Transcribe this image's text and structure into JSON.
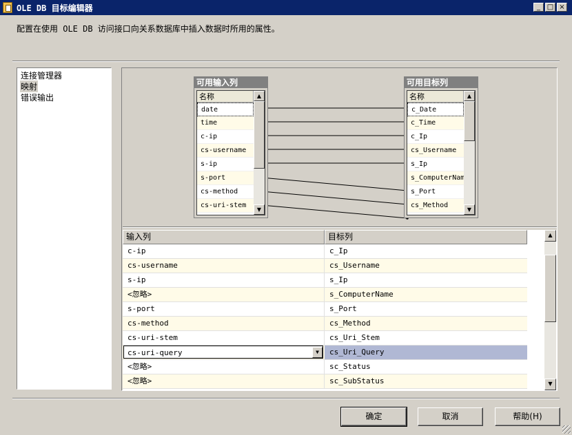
{
  "window": {
    "title": "OLE DB 目标编辑器",
    "controls": {
      "minimize": "_",
      "maximize": "□",
      "close": "×"
    }
  },
  "description": "配置在使用 OLE DB 访问接口向关系数据库中插入数据时所用的属性。",
  "nav": {
    "items": [
      {
        "label": "连接管理器",
        "selected": false
      },
      {
        "label": "映射",
        "selected": true
      },
      {
        "label": "错误输出",
        "selected": false
      }
    ]
  },
  "mapping": {
    "input_box": {
      "title": "可用输入列",
      "header": "名称",
      "rows": [
        "date",
        "time",
        "c-ip",
        "cs-username",
        "s-ip",
        "s-port",
        "cs-method",
        "cs-uri-stem"
      ]
    },
    "output_box": {
      "title": "可用目标列",
      "header": "名称",
      "rows": [
        "c_Date",
        "c_Time",
        "c_Ip",
        "cs_Username",
        "s_Ip",
        "s_ComputerName",
        "s_Port",
        "cs_Method"
      ]
    },
    "links": [
      [
        0,
        0
      ],
      [
        1,
        1
      ],
      [
        2,
        2
      ],
      [
        3,
        3
      ],
      [
        4,
        4
      ],
      [
        5,
        6
      ],
      [
        6,
        7
      ],
      [
        7,
        8
      ]
    ]
  },
  "grid": {
    "headers": {
      "input": "输入列",
      "target": "目标列"
    },
    "rows": [
      {
        "input": "c-ip",
        "target": "c_Ip"
      },
      {
        "input": "cs-username",
        "target": "cs_Username"
      },
      {
        "input": "s-ip",
        "target": "s_Ip"
      },
      {
        "input": "<忽略>",
        "target": "s_ComputerName"
      },
      {
        "input": "s-port",
        "target": "s_Port"
      },
      {
        "input": "cs-method",
        "target": "cs_Method"
      },
      {
        "input": "cs-uri-stem",
        "target": "cs_Uri_Stem"
      },
      {
        "input": "cs-uri-query",
        "target": "cs_Uri_Query",
        "editing": true
      },
      {
        "input": "<忽略>",
        "target": "sc_Status"
      },
      {
        "input": "<忽略>",
        "target": "sc_SubStatus"
      }
    ]
  },
  "buttons": {
    "ok": "确定",
    "cancel": "取消",
    "help": "帮助(H)"
  },
  "icons": {
    "app": "ssis-destination-icon",
    "scroll_up": "▲",
    "scroll_down": "▼",
    "combo": "▼"
  }
}
